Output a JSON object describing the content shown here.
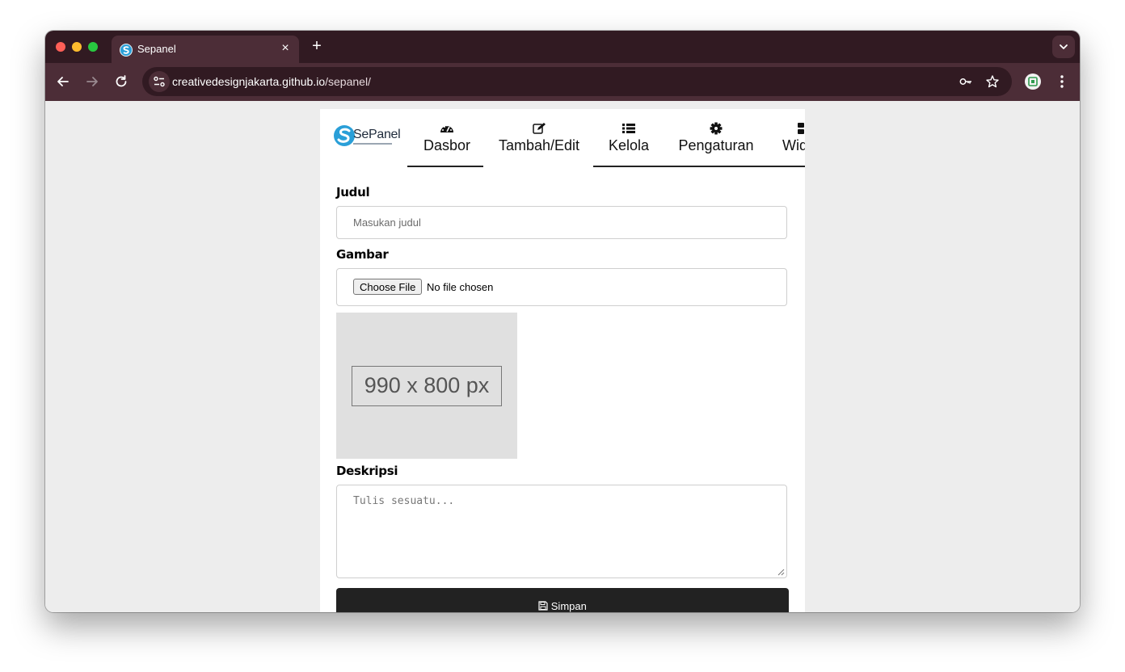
{
  "browser": {
    "tab_title": "Sepanel",
    "tab_close": "×",
    "new_tab": "+",
    "url_host": "creativedesignjakarta.github.io",
    "url_path": "/sepanel/",
    "icons": [
      "back-arrow-icon",
      "forward-arrow-icon",
      "reload-icon",
      "site-info-icon",
      "password-key-icon",
      "bookmark-star-icon",
      "profile-icon",
      "menu-dots-icon",
      "tab-search-icon"
    ]
  },
  "app": {
    "brand": "SePanel",
    "nav": [
      {
        "label": "Dasbor",
        "icon": "dashboard-gauge-icon"
      },
      {
        "label": "Tambah/Edit",
        "icon": "edit-icon"
      },
      {
        "label": "Kelola",
        "icon": "list-icon"
      },
      {
        "label": "Pengaturan",
        "icon": "gear-icon"
      },
      {
        "label": "Wid",
        "icon": "widget-icon"
      }
    ]
  },
  "form": {
    "title_label": "Judul",
    "title_placeholder": "Masukan judul",
    "image_label": "Gambar",
    "file_button": "Choose File",
    "file_status": "No file chosen",
    "preview_text": "990 x 800 px",
    "desc_label": "Deskripsi",
    "desc_placeholder": "Tulis sesuatu...",
    "save_label": "Simpan",
    "save_icon": "save-disk-icon"
  },
  "colors": {
    "titlebar": "#311a22",
    "toolbar": "#4c2d37",
    "page_bg": "#ededed",
    "button_dark": "#222222"
  }
}
